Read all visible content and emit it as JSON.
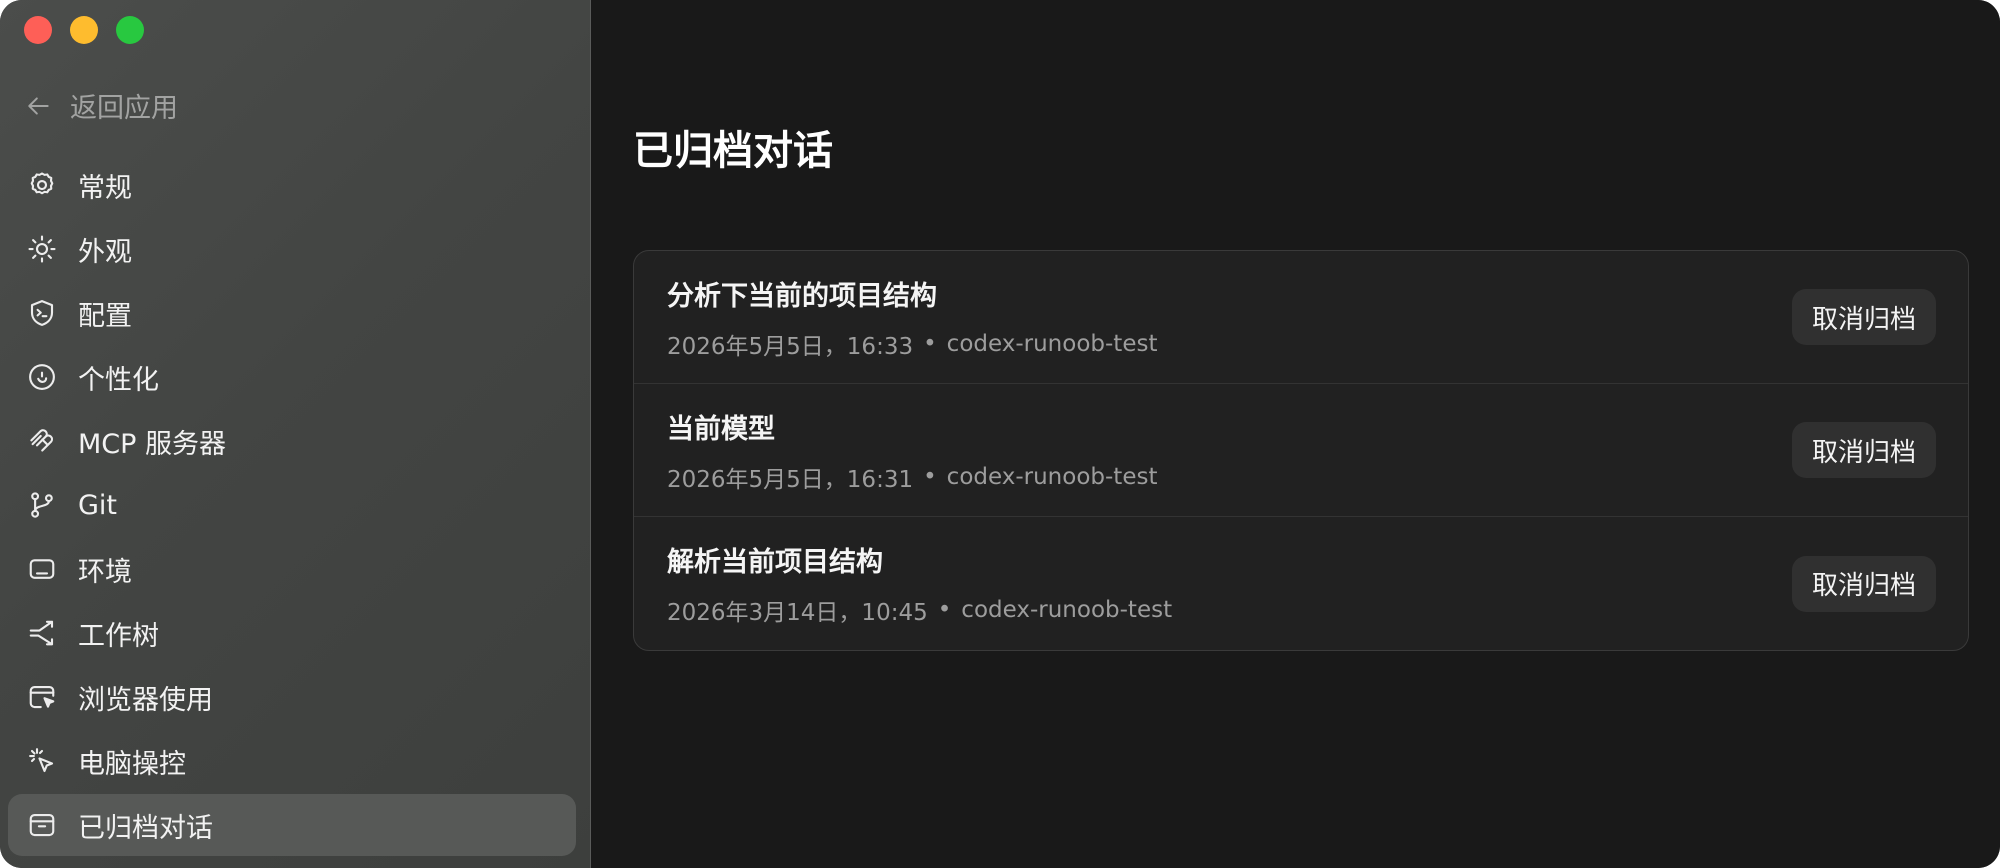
{
  "sidebar": {
    "back_label": "返回应用",
    "items": [
      {
        "label": "常规",
        "icon": "gear-icon",
        "active": false
      },
      {
        "label": "外观",
        "icon": "sun-icon",
        "active": false
      },
      {
        "label": "配置",
        "icon": "shield-terminal-icon",
        "active": false
      },
      {
        "label": "个性化",
        "icon": "smile-icon",
        "active": false
      },
      {
        "label": "MCP 服务器",
        "icon": "mcp-icon",
        "active": false
      },
      {
        "label": "Git",
        "icon": "git-branch-icon",
        "active": false
      },
      {
        "label": "环境",
        "icon": "monitor-icon",
        "active": false
      },
      {
        "label": "工作树",
        "icon": "worktree-icon",
        "active": false
      },
      {
        "label": "浏览器使用",
        "icon": "browser-cursor-icon",
        "active": false
      },
      {
        "label": "电脑操控",
        "icon": "click-cursor-icon",
        "active": false
      },
      {
        "label": "已归档对话",
        "icon": "archive-icon",
        "active": true
      }
    ]
  },
  "main": {
    "title": "已归档对话",
    "conversations": [
      {
        "title": "分析下当前的项目结构",
        "date": "2026年5月5日，16:33",
        "project": "codex-runoob-test",
        "action": "取消归档"
      },
      {
        "title": "当前模型",
        "date": "2026年5月5日，16:31",
        "project": "codex-runoob-test",
        "action": "取消归档"
      },
      {
        "title": "解析当前项目结构",
        "date": "2026年3月14日，10:45",
        "project": "codex-runoob-test",
        "action": "取消归档"
      }
    ],
    "separator": "•"
  },
  "colors": {
    "traffic_close": "#fe5f57",
    "traffic_minimize": "#febc2e",
    "traffic_maximize": "#28c840",
    "main_background": "#191919",
    "card_background": "#212121",
    "button_background": "#303030"
  }
}
